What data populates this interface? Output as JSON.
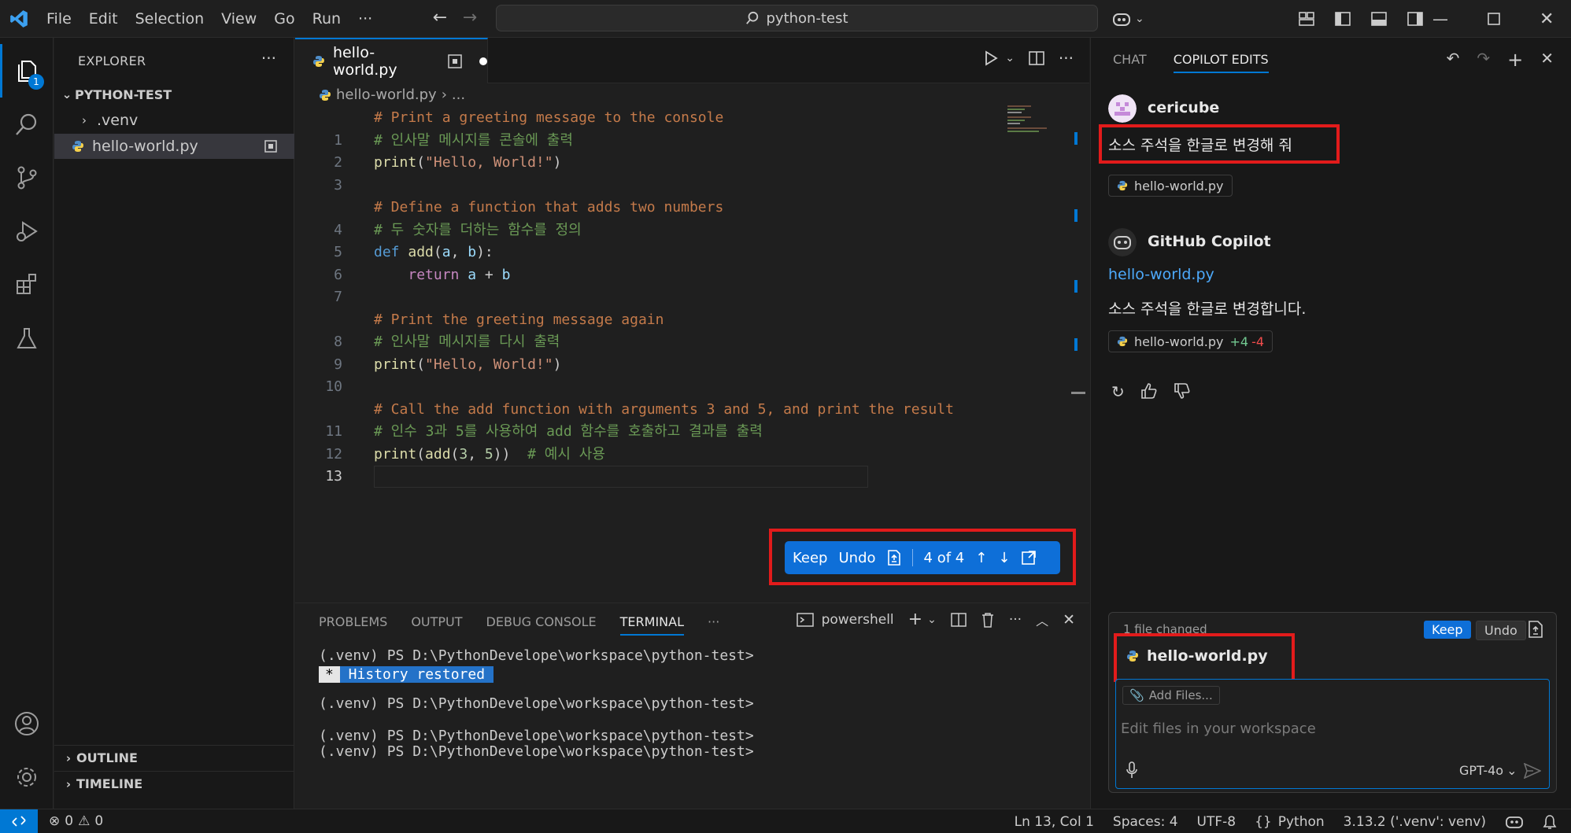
{
  "titlebar": {
    "menu": [
      "File",
      "Edit",
      "Selection",
      "View",
      "Go",
      "Run",
      "···"
    ],
    "search": "python-test"
  },
  "activity": {
    "explorer_badge": "1"
  },
  "sidebar": {
    "title": "EXPLORER",
    "more": "···",
    "root": "PYTHON-TEST",
    "items": [
      ".venv",
      "hello-world.py"
    ],
    "outline": "OUTLINE",
    "timeline": "TIMELINE"
  },
  "editor": {
    "tab": "hello-world.py",
    "breadcrumb_file": "hello-world.py",
    "breadcrumb_more": "...",
    "widget": {
      "keep": "Keep",
      "undo": "Undo",
      "counter": "4 of 4"
    },
    "lines": [
      {
        "num": "",
        "diff": "del",
        "parts": [
          {
            "c": "k-comment-del",
            "t": "# Print a greeting message to the console"
          }
        ]
      },
      {
        "num": "1",
        "diff": "ins",
        "parts": [
          {
            "c": "k-comment",
            "t": "# 인사말 메시지를 콘솔에 출력"
          }
        ]
      },
      {
        "num": "2",
        "diff": "",
        "parts": [
          {
            "c": "k-fn",
            "t": "print"
          },
          {
            "c": "",
            "t": "("
          },
          {
            "c": "k-str",
            "t": "\"Hello, World!\""
          },
          {
            "c": "",
            "t": ")"
          }
        ]
      },
      {
        "num": "3",
        "diff": "",
        "parts": []
      },
      {
        "num": "",
        "diff": "del",
        "parts": [
          {
            "c": "k-comment-del",
            "t": "# Define a function that adds two numbers"
          }
        ]
      },
      {
        "num": "4",
        "diff": "ins",
        "parts": [
          {
            "c": "k-comment",
            "t": "# 두 숫자를 더하는 함수를 정의"
          }
        ]
      },
      {
        "num": "5",
        "diff": "",
        "parts": [
          {
            "c": "k-kw",
            "t": "def "
          },
          {
            "c": "k-fn",
            "t": "add"
          },
          {
            "c": "",
            "t": "("
          },
          {
            "c": "k-var",
            "t": "a"
          },
          {
            "c": "",
            "t": ", "
          },
          {
            "c": "k-var",
            "t": "b"
          },
          {
            "c": "",
            "t": "):"
          }
        ]
      },
      {
        "num": "6",
        "diff": "",
        "parts": [
          {
            "c": "",
            "t": "    "
          },
          {
            "c": "k-ret",
            "t": "return "
          },
          {
            "c": "k-var",
            "t": "a"
          },
          {
            "c": "",
            "t": " + "
          },
          {
            "c": "k-var",
            "t": "b"
          }
        ]
      },
      {
        "num": "7",
        "diff": "",
        "parts": []
      },
      {
        "num": "",
        "diff": "del",
        "parts": [
          {
            "c": "k-comment-del",
            "t": "# Print the greeting message again"
          }
        ]
      },
      {
        "num": "8",
        "diff": "ins",
        "parts": [
          {
            "c": "k-comment",
            "t": "# 인사말 메시지를 다시 출력"
          }
        ]
      },
      {
        "num": "9",
        "diff": "",
        "parts": [
          {
            "c": "k-fn",
            "t": "print"
          },
          {
            "c": "",
            "t": "("
          },
          {
            "c": "k-str",
            "t": "\"Hello, World!\""
          },
          {
            "c": "",
            "t": ")"
          }
        ]
      },
      {
        "num": "10",
        "diff": "",
        "parts": []
      },
      {
        "num": "",
        "diff": "del",
        "parts": [
          {
            "c": "k-comment-del",
            "t": "# Call the add function with arguments 3 and 5, and print the result"
          }
        ]
      },
      {
        "num": "11",
        "diff": "ins",
        "parts": [
          {
            "c": "k-comment",
            "t": "# 인수 3과 5를 사용하여 add 함수를 호출하고 결과를 출력"
          }
        ]
      },
      {
        "num": "12",
        "diff": "",
        "parts": [
          {
            "c": "k-fn",
            "t": "print"
          },
          {
            "c": "",
            "t": "("
          },
          {
            "c": "k-fn",
            "t": "add"
          },
          {
            "c": "",
            "t": "("
          },
          {
            "c": "k-num",
            "t": "3"
          },
          {
            "c": "",
            "t": ", "
          },
          {
            "c": "k-num",
            "t": "5"
          },
          {
            "c": "",
            "t": "))  "
          },
          {
            "c": "k-comment",
            "t": "# 예시 사용"
          }
        ]
      },
      {
        "num": "13",
        "diff": "cur",
        "parts": []
      }
    ]
  },
  "panel": {
    "tabs": [
      "PROBLEMS",
      "OUTPUT",
      "DEBUG CONSOLE",
      "TERMINAL",
      "···"
    ],
    "active_tab": "TERMINAL",
    "shell": "powershell",
    "prompt": "(.venv) PS D:\\PythonDevelope\\workspace\\python-test>",
    "restored_star": "*",
    "restored_text": " History restored "
  },
  "chat": {
    "tabs": [
      "CHAT",
      "COPILOT EDITS"
    ],
    "active_tab": "COPILOT EDITS",
    "user_name": "cericube",
    "user_message": "소스 주석을 한글로 변경해 줘",
    "user_file": "hello-world.py",
    "bot_name": "GitHub Copilot",
    "bot_link": "hello-world.py",
    "bot_message": "소스 주석을 한글로 변경합니다.",
    "bot_file": "hello-world.py",
    "bot_added": "+4",
    "bot_removed": "-4",
    "files_changed": "1 file changed",
    "keep": "Keep",
    "undo": "Undo",
    "changed_file": "hello-world.py",
    "add_files": "Add Files...",
    "input_placeholder": "Edit files in your workspace",
    "model": "GPT-4o"
  },
  "status": {
    "errors": "0",
    "warnings": "0",
    "position": "Ln 13, Col 1",
    "spaces": "Spaces: 4",
    "encoding": "UTF-8",
    "language": "Python",
    "interpreter": "3.13.2 ('.venv': venv)"
  },
  "colors": {
    "accent": "#0078d4",
    "highlight_frame": "#e21b1b",
    "deleted_bg": "#4b1818",
    "inserted_bg": "#373d29"
  }
}
